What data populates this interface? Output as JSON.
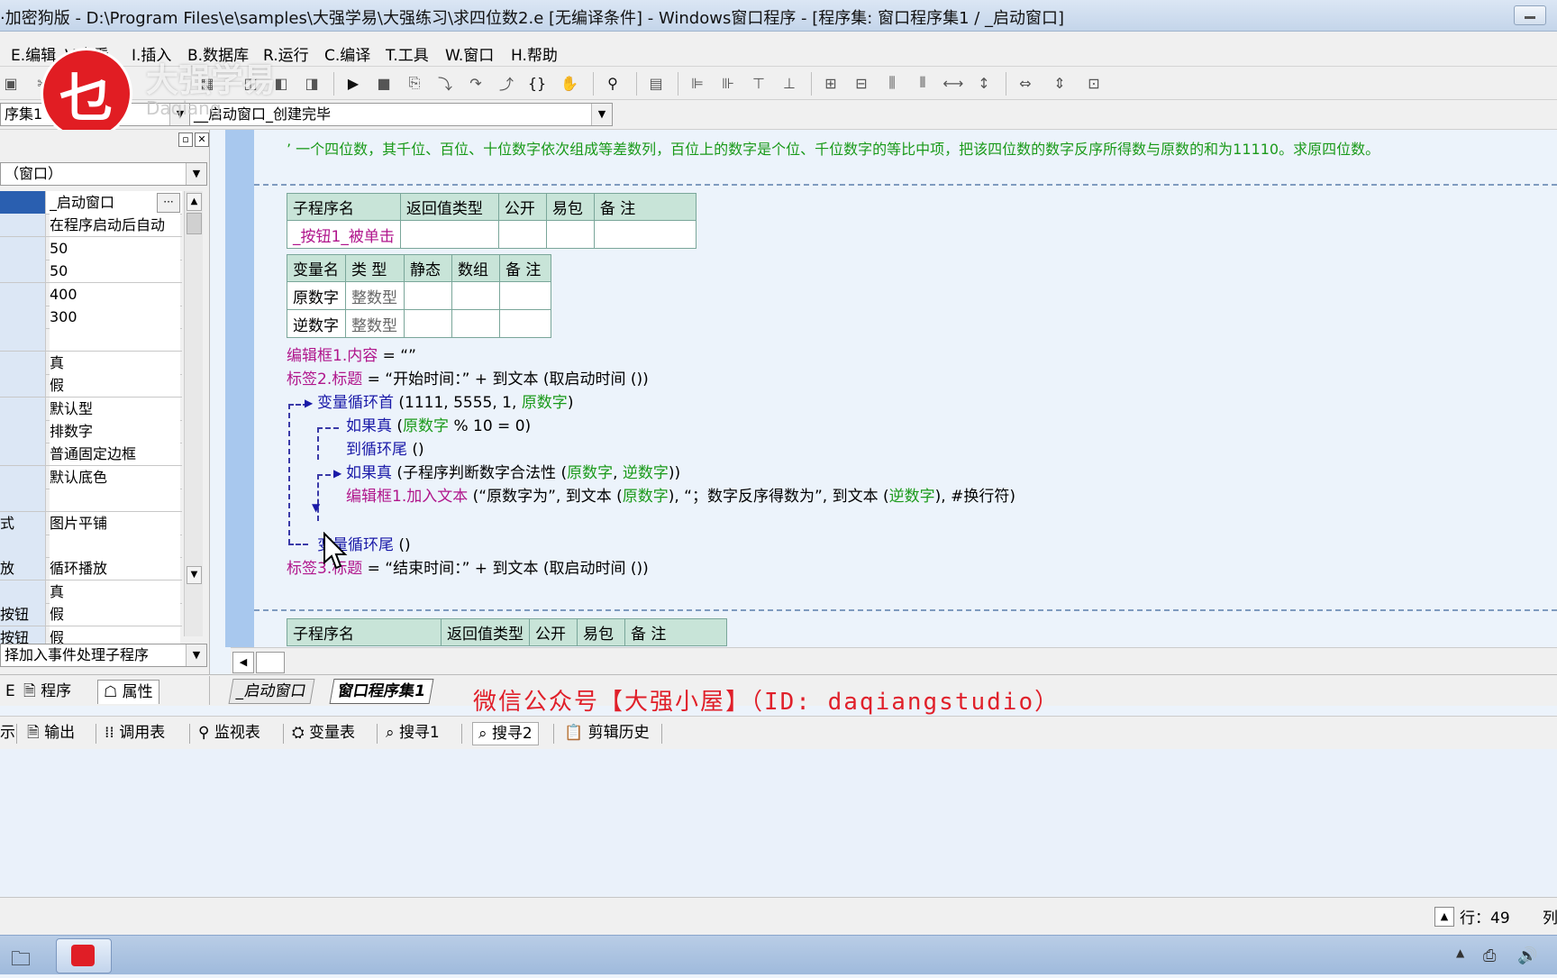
{
  "titlebar": {
    "title": "·加密狗版 - D:\\Program Files\\e\\samples\\大强学易\\大强练习\\求四位数2.e [无编译条件] - Windows窗口程序 - [程序集: 窗口程序集1 / _启动窗口]"
  },
  "menu": [
    "E.编辑",
    "V.查看",
    "I.插入",
    "B.数据库",
    "R.运行",
    "C.编译",
    "T.工具",
    "W.窗口",
    "H.帮助"
  ],
  "watermark": {
    "logo": "乜",
    "text1": "大强学易",
    "text2": "Daqiang"
  },
  "combos": {
    "assembly": "序集1",
    "sub": "__启动窗口_创建完毕"
  },
  "leftpanel": {
    "object_combo": "（窗口）",
    "event_combo": "择加入事件处理子程序",
    "tab_program": "程序",
    "tab_property": "属性",
    "tab_stub": "E",
    "properties": [
      {
        "name": "",
        "value": "_启动窗口"
      },
      {
        "name": "",
        "value": "在程序启动后自动"
      },
      {
        "name": "",
        "value": "50"
      },
      {
        "name": "",
        "value": "50"
      },
      {
        "name": "",
        "value": "400"
      },
      {
        "name": "",
        "value": "300"
      },
      {
        "name": "",
        "value": ""
      },
      {
        "name": "",
        "value": "真"
      },
      {
        "name": "",
        "value": "假"
      },
      {
        "name": "",
        "value": "默认型"
      },
      {
        "name": "",
        "value": "排数字"
      },
      {
        "name": "",
        "value": "普通固定边框"
      },
      {
        "name": "",
        "value": "默认底色"
      },
      {
        "name": "",
        "value": ""
      },
      {
        "name": "式",
        "value": "图片平铺"
      },
      {
        "name": "",
        "value": ""
      },
      {
        "name": "放",
        "value": "循环播放"
      },
      {
        "name": "",
        "value": "真"
      },
      {
        "name": "按钮",
        "value": "假"
      },
      {
        "name": "按钮",
        "value": "假"
      }
    ]
  },
  "code": {
    "comment": "’ 一个四位数，其千位、百位、十位数字依次组成等差数列，百位上的数字是个位、千位数字的等比中项，把该四位数的数字反序所得数与原数的和为11110。求原四位数。",
    "sub_headers": [
      "子程序名",
      "返回值类型",
      "公开",
      "易包",
      "备 注"
    ],
    "sub_name": "_按钮1_被单击",
    "var_headers": [
      "变量名",
      "类 型",
      "静态",
      "数组",
      "备 注"
    ],
    "vars": [
      {
        "name": "原数字",
        "type": "整数型"
      },
      {
        "name": "逆数字",
        "type": "整数型"
      }
    ],
    "l1": {
      "obj": "编辑框1.",
      "prop": "内容",
      "rest": " = “”"
    },
    "l2": {
      "obj": "标签2.",
      "prop": "标题",
      "rest": " = “开始时间：” + 到文本 (取启动时间 ())"
    },
    "l3": {
      "kw": "变量循环首",
      "rest1": " (1111, 5555, 1, ",
      "var": "原数字",
      "rest2": ")"
    },
    "l4": {
      "kw": "如果真",
      "rest1": " (",
      "var": "原数字",
      "rest2": " % 10 = 0)"
    },
    "l5": {
      "kw": "到循环尾",
      "rest": " ()"
    },
    "l6": {
      "kw": "如果真",
      "rest1": " (子程序判断数字合法性 (",
      "var1": "原数字",
      "sep": ", ",
      "var2": "逆数字",
      "rest2": "))"
    },
    "l7": {
      "obj": "编辑框1.",
      "prop": "加入文本",
      "p1": " (“原数字为”, 到文本 (",
      "v1": "原数字",
      "p2": "), “；数字反序得数为”, 到文本 (",
      "v2": "逆数字",
      "p3": "), #换行符)"
    },
    "l8": {
      "kw": "变量循环尾",
      "rest": " ()"
    },
    "l9": {
      "obj": "标签3.",
      "prop": "标题",
      "rest": " = “结束时间：” + 到文本 (取启动时间 ())"
    },
    "arrow": "››",
    "sub2_headers": [
      "子程序名",
      "返回值类型",
      "公开",
      "易包",
      "备 注"
    ]
  },
  "tabs": [
    "_启动窗口",
    "窗口程序集1"
  ],
  "wechat": "微信公众号【大强小屋】（ID: daqiangstudio）",
  "output_tabs": [
    "示",
    "输出",
    "调用表",
    "监视表",
    "变量表",
    "搜寻1",
    "搜寻2",
    "剪辑历史"
  ],
  "status": {
    "row": "行：49",
    "extra": "列"
  }
}
